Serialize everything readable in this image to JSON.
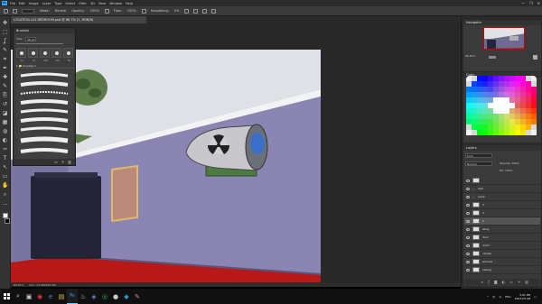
{
  "app": {
    "logo": "Ps",
    "menu": [
      "File",
      "Edit",
      "Image",
      "Layer",
      "Type",
      "Select",
      "Filter",
      "3D",
      "View",
      "Window",
      "Help"
    ],
    "window_controls": [
      "—",
      "❐",
      "✕"
    ]
  },
  "options_bar": {
    "items": [
      "Mode:",
      "Normal",
      "Opacity:",
      "100%",
      "Flow:",
      "100%",
      "Smoothing:",
      "0%"
    ]
  },
  "document": {
    "tab_label": "LOCATION v12 BEDROOM.psd @ 66.7% (1, RGB/8)",
    "status_zoom": "66.67%",
    "status_doc": "Doc: 12.0M/262.0M"
  },
  "toolbar": {
    "tools": [
      "move-icon",
      "marquee-icon",
      "lasso-icon",
      "quick-select-icon",
      "crop-icon",
      "eyedropper-icon",
      "healing-icon",
      "brush-icon",
      "stamp-icon",
      "history-brush-icon",
      "eraser-icon",
      "gradient-icon",
      "blur-icon",
      "dodge-icon",
      "pen-icon",
      "type-icon",
      "path-select-icon",
      "shape-icon",
      "hand-icon",
      "zoom-icon",
      "more-icon"
    ],
    "glyphs": [
      "✥",
      "⬚",
      "ʆ",
      "✎",
      "⌗",
      "✒",
      "✚",
      "✎",
      "⎘",
      "↺",
      "◪",
      "▦",
      "◍",
      "◐",
      "✑",
      "T",
      "↖",
      "▭",
      "✋",
      "⌕",
      "…"
    ]
  },
  "brush_panel": {
    "title": "Brushes",
    "size_label": "Size:",
    "size_value": "26 px",
    "presets": [
      {
        "label": "14"
      },
      {
        "label": "24"
      },
      {
        "label": "500"
      },
      {
        "label": "120"
      },
      {
        "label": "80"
      }
    ],
    "group_label": "▾ 📁 brushes 1",
    "bottom_icons": [
      "folder-icon",
      "new-icon",
      "trash-icon"
    ]
  },
  "navigator": {
    "title": "Navigator",
    "zoom": "66.67%"
  },
  "color_panel": {
    "title": "Color"
  },
  "layers_panel": {
    "title": "Layers",
    "search_label": "Kind",
    "blend_mode": "Normal",
    "opacity_label": "Opacity: 100%",
    "fill_label": "Fill: 100%",
    "layers": [
      {
        "name": "",
        "type": "thumb"
      },
      {
        "name": "wall",
        "type": "group"
      },
      {
        "name": "plant",
        "type": "group"
      },
      {
        "name": "3",
        "type": "thumb"
      },
      {
        "name": "2",
        "type": "thumb"
      },
      {
        "name": "1",
        "type": "thumb",
        "selected": true
      },
      {
        "name": "lamp",
        "type": "thumb"
      },
      {
        "name": "door",
        "type": "thumb"
      },
      {
        "name": "room",
        "type": "thumb"
      },
      {
        "name": "carpet",
        "type": "thumb"
      },
      {
        "name": "window",
        "type": "thumb"
      },
      {
        "name": "ceiling",
        "type": "thumb"
      }
    ],
    "bottom_icons": [
      "link-icon",
      "fx-icon",
      "mask-icon",
      "adjust-icon",
      "folder-icon",
      "new-layer-icon",
      "trash-icon"
    ]
  },
  "taskbar": {
    "apps": [
      "search-icon",
      "task-view-icon",
      "chrome-icon",
      "explorer-icon",
      "files-icon",
      "photoshop-icon",
      "steam-icon",
      "discord-icon",
      "spotify-icon",
      "obs-icon",
      "edge-icon",
      "paint-icon"
    ],
    "glyphs": [
      "⌕",
      "▣",
      "◉",
      "e",
      "▤",
      "Ps",
      "♨",
      "◈",
      "◎",
      "●",
      "◆",
      "✎"
    ],
    "active_index": 5,
    "language": "ENG",
    "time": "3:01 PM",
    "date": "2023-05-08"
  }
}
